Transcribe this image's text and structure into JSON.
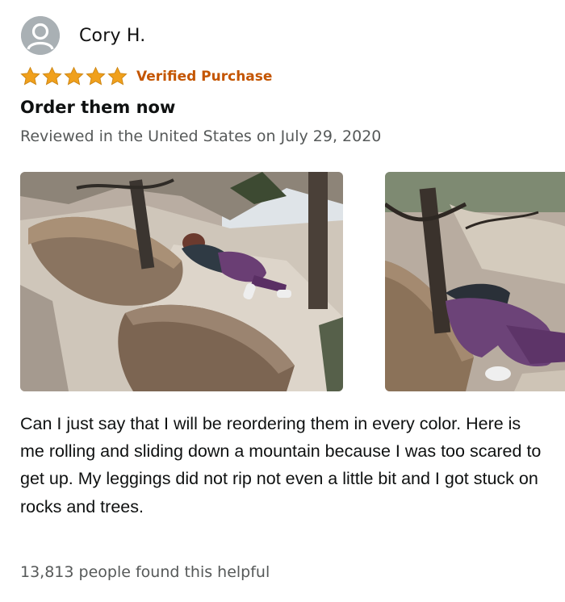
{
  "reviewer": {
    "name": "Cory H.",
    "avatar_icon": "user-silhouette-icon"
  },
  "rating": {
    "stars": 5,
    "max": 5,
    "star_color": "#f0a01c",
    "badge": "Verified Purchase",
    "badge_color": "#c45500"
  },
  "review": {
    "title": "Order them now",
    "date_line": "Reviewed in the United States on July 29, 2020",
    "photos": [
      "review-photo-1",
      "review-photo-2"
    ],
    "body": "Can I just say that I will be reordering them in every color. Here is me rolling and sliding down a mountain because I was too scared to get up. My leggings did not rip not even a little bit and I got stuck on rocks and trees.",
    "helpful_text": "13,813 people found this helpful"
  }
}
